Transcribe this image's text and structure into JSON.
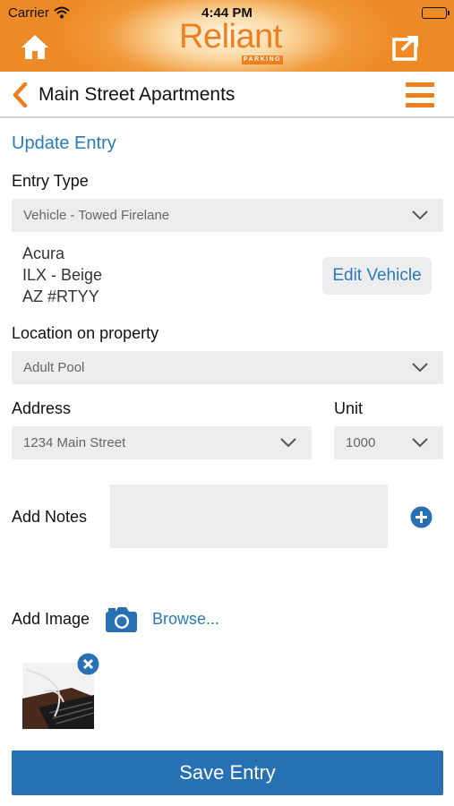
{
  "status_bar": {
    "carrier": "Carrier",
    "time": "4:44 PM"
  },
  "top_bar": {
    "logo_text": "Reliant",
    "logo_subtext": "PARKING",
    "icons": {
      "home": "home-icon",
      "share": "share-icon"
    }
  },
  "header": {
    "title": "Main Street Apartments",
    "back_icon": "chevron-left-icon",
    "menu_icon": "hamburger-menu-icon"
  },
  "form": {
    "section_title": "Update Entry",
    "entry_type": {
      "label": "Entry Type",
      "value": "Vehicle - Towed Firelane"
    },
    "vehicle": {
      "make": "Acura",
      "model_color": "ILX - Beige",
      "plate": "AZ #RTYY",
      "edit_label": "Edit Vehicle"
    },
    "location": {
      "label": "Location on property",
      "value": "Adult Pool"
    },
    "address": {
      "label": "Address",
      "value": "1234 Main Street"
    },
    "unit": {
      "label": "Unit",
      "value": "1000"
    },
    "notes": {
      "label": "Add Notes",
      "value": ""
    },
    "image": {
      "label": "Add Image",
      "browse_label": "Browse..."
    },
    "save_label": "Save Entry"
  },
  "colors": {
    "accent_orange": "#ee7f1c",
    "link_blue": "#2a7bb8",
    "primary_button": "#2670b3",
    "field_bg": "#ededf0"
  }
}
